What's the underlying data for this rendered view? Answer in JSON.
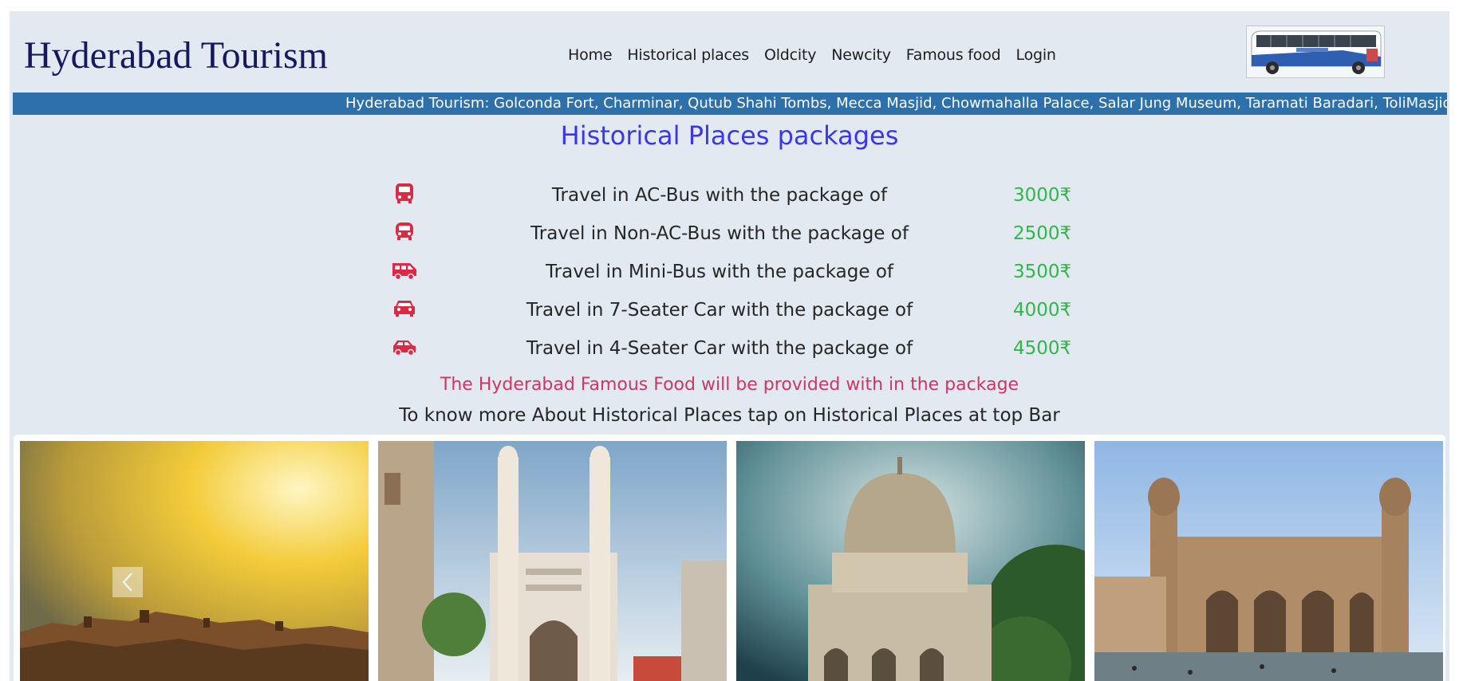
{
  "header": {
    "brand": "Hyderabad Tourism",
    "nav": [
      "Home",
      "Historical places",
      "Oldcity",
      "Newcity",
      "Famous food",
      "Login"
    ],
    "bus_image_icon": "bus-photo"
  },
  "ticker": {
    "text": "Hyderabad Tourism: Golconda Fort, Charminar, Qutub Shahi Tombs, Mecca Masjid, Chowmahalla Palace, Salar Jung Museum, Taramati Baradari, ToliMasjid, Paigah Tombs"
  },
  "main": {
    "title": "Historical Places packages",
    "packages": [
      {
        "icon": "bus-icon",
        "label": "Travel in AC-Bus with the package of",
        "price": "3000₹"
      },
      {
        "icon": "bus-front-icon",
        "label": "Travel in Non-AC-Bus with the package of",
        "price": "2500₹"
      },
      {
        "icon": "van-icon",
        "label": "Travel in Mini-Bus with the package of",
        "price": "3500₹"
      },
      {
        "icon": "car-front-icon",
        "label": "Travel in 7-Seater Car with the package of",
        "price": "4000₹"
      },
      {
        "icon": "car-side-icon",
        "label": "Travel in 4-Seater Car with the package of",
        "price": "4500₹"
      }
    ],
    "food_note": "The Hyderabad Famous Food will be provided with in the package",
    "more_note": "To know more About Historical Places tap on Historical Places at top Bar"
  },
  "gallery": {
    "photos": [
      "golconda-fort-photo",
      "charminar-photo",
      "qutub-shahi-tomb-photo",
      "mecca-masjid-photo"
    ],
    "prev_icon": "chevron-left-icon"
  },
  "colors": {
    "brand": "#151a5e",
    "ticker_bg": "#2d70aa",
    "title": "#3b37e6",
    "icon": "#dd2846",
    "price": "#2fb84a",
    "food_note": "#cc3765"
  }
}
